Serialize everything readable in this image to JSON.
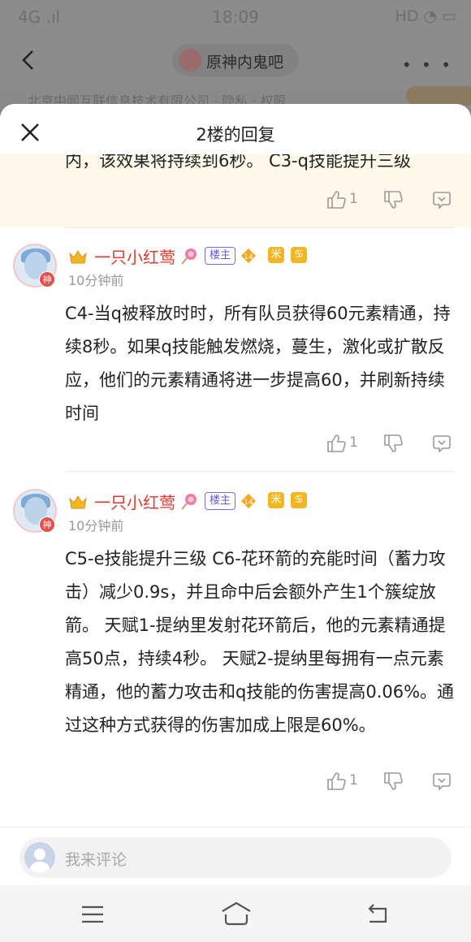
{
  "status_bar": {
    "network": "4G .ıl",
    "time": "18:09",
    "indicators": "HD ◔ ▭"
  },
  "top_bar": {
    "forum_name": "原神内鬼吧",
    "back_icon": "chevron-left-icon",
    "more_icon": "more-dots-icon"
  },
  "background_text": "北京中闻互联信息技术有限公司 · 隐私 · 权限",
  "sheet": {
    "title": "2楼的回复",
    "close_icon": "close-icon",
    "main_post": {
      "text": "内，该效果将持续到6秒。 C3-q技能提升三级",
      "like_count": "1"
    },
    "replies": [
      {
        "username": "一只小红莺",
        "op_badge": "楼主",
        "level": "14",
        "god_badge": "神",
        "zodiac1": "米",
        "zodiac2": "♋",
        "time": "10分钟前",
        "content": "C4-当q被释放时时，所有队员获得60元素精通，持续8秒。如果q技能触发燃烧，蔓生，激化或扩散反应，他们的元素精通将进一步提高60，并刷新持续时间",
        "like_count": "1"
      },
      {
        "username": "一只小红莺",
        "op_badge": "楼主",
        "level": "14",
        "god_badge": "神",
        "zodiac1": "米",
        "zodiac2": "♋",
        "time": "10分钟前",
        "content": "C5-e技能提升三级 C6-花环箭的充能时间（蓄力攻击）减少0.9s，并且命中后会额外产生1个簇绽放箭。 天赋1-提纳里发射花环箭后，他的元素精通提高50点，持续4秒。 天赋2-提纳里每拥有一点元素精通，他的蓄力攻击和q技能的伤害提高0.06%。通过这种方式获得的伤害加成上限是60%。",
        "like_count": "1"
      }
    ]
  },
  "comment_bar": {
    "placeholder": "我来评论"
  },
  "colors": {
    "username": "#e4392f",
    "op_badge": "#6a56d6",
    "main_post_bg": "#fdf8e9",
    "zodiac": "#f2b623"
  }
}
